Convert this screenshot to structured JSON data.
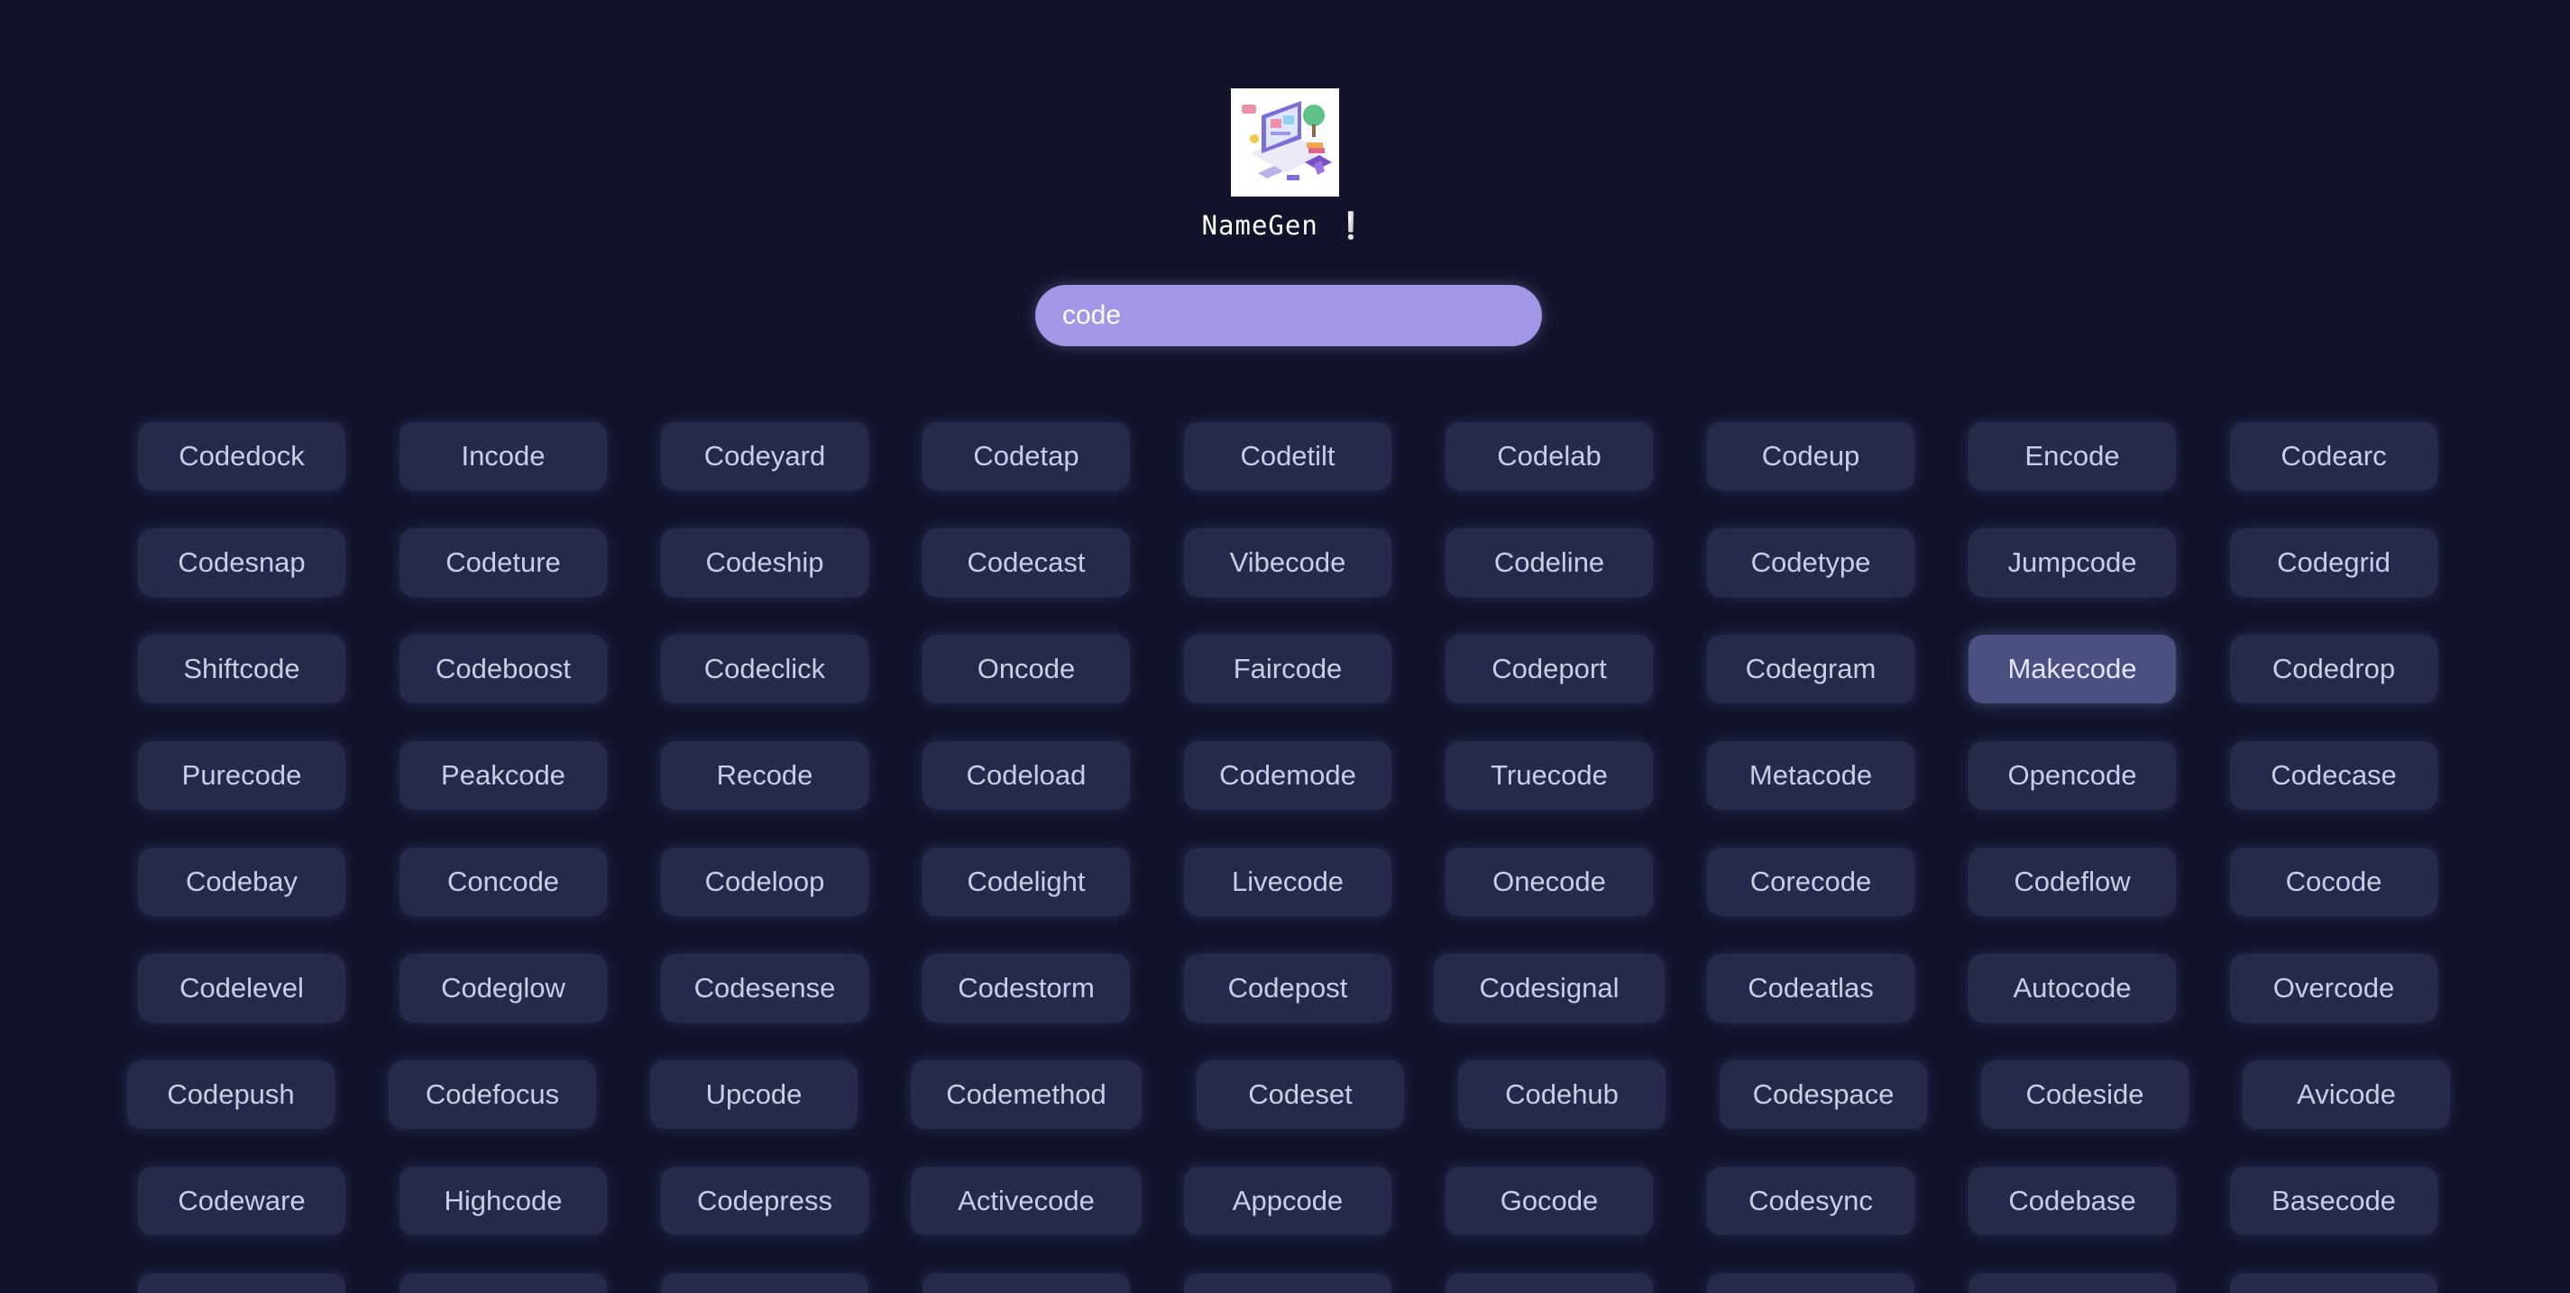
{
  "app": {
    "title": "NameGen ❕",
    "logo_icon": "coding-workspace-illustration"
  },
  "search": {
    "value": "code",
    "placeholder": ""
  },
  "colors": {
    "background": "#10132a",
    "chip": "#252a4a",
    "chip_selected": "#4a5180",
    "search": "#a197e6"
  },
  "names": [
    [
      "Codedock",
      "Incode",
      "Codeyard",
      "Codetap",
      "Codetilt",
      "Codelab",
      "Codeup",
      "Encode",
      "Codearc"
    ],
    [
      "Codesnap",
      "Codeture",
      "Codeship",
      "Codecast",
      "Vibecode",
      "Codeline",
      "Codetype",
      "Jumpcode",
      "Codegrid"
    ],
    [
      "Shiftcode",
      "Codeboost",
      "Codeclick",
      "Oncode",
      "Faircode",
      "Codeport",
      "Codegram",
      "Makecode",
      "Codedrop"
    ],
    [
      "Purecode",
      "Peakcode",
      "Recode",
      "Codeload",
      "Codemode",
      "Truecode",
      "Metacode",
      "Opencode",
      "Codecase"
    ],
    [
      "Codebay",
      "Concode",
      "Codeloop",
      "Codelight",
      "Livecode",
      "Onecode",
      "Corecode",
      "Codeflow",
      "Cocode"
    ],
    [
      "Codelevel",
      "Codeglow",
      "Codesense",
      "Codestorm",
      "Codepost",
      "Codesignal",
      "Codeatlas",
      "Autocode",
      "Overcode"
    ],
    [
      "Codepush",
      "Codefocus",
      "Upcode",
      "Codemethod",
      "Codeset",
      "Codehub",
      "Codespace",
      "Codeside",
      "Avicode"
    ],
    [
      "Codeware",
      "Highcode",
      "Codepress",
      "Activecode",
      "Appcode",
      "Gocode",
      "Codesync",
      "Codebase",
      "Basecode"
    ]
  ],
  "selected_name": "Makecode"
}
